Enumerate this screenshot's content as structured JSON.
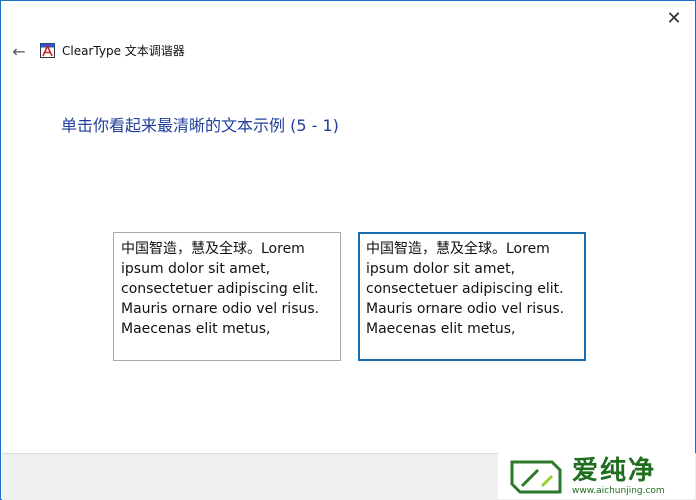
{
  "window": {
    "title": "ClearType 文本调谐器",
    "close_label": "✕",
    "back_label": "←"
  },
  "heading": "单击你看起来最清晰的文本示例 (5 - 1)",
  "samples": [
    {
      "text": "中国智造，慧及全球。Lorem ipsum dolor sit amet, consectetuer adipiscing elit. Mauris ornare odio vel risus. Maecenas elit metus,"
    },
    {
      "text": "中国智造，慧及全球。Lorem ipsum dolor sit amet, consectetuer adipiscing elit. Mauris ornare odio vel risus. Maecenas elit metus,"
    }
  ],
  "selected_sample": 2,
  "watermark": {
    "big": "爱纯净",
    "small": "www.aichunjing.com"
  },
  "icons": {
    "back": "back-arrow-icon",
    "app": "cleartype-app-icon",
    "close": "close-icon"
  },
  "colors": {
    "heading": "#1f3f9a",
    "selected_border": "#1a6fb3",
    "window_border": "#1a73c8"
  }
}
